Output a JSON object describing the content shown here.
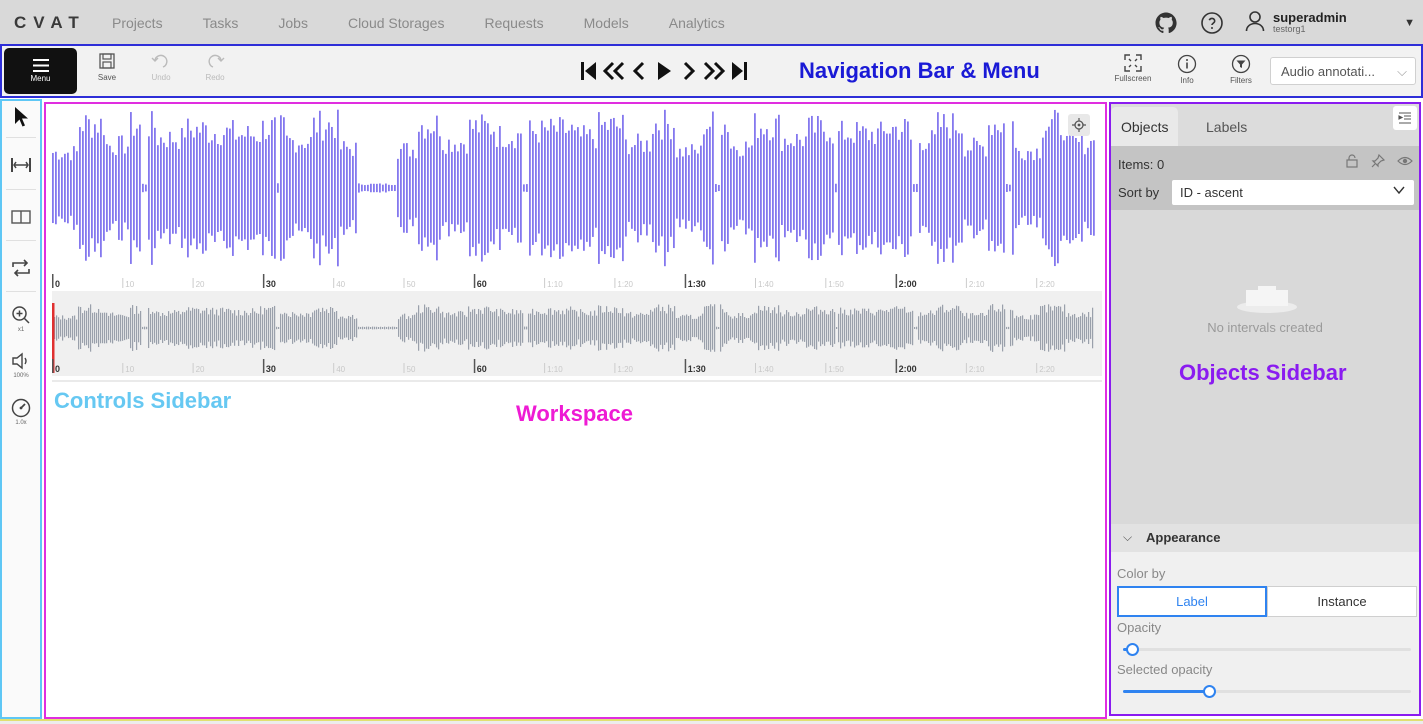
{
  "header": {
    "logo": "CVAT",
    "nav": [
      "Projects",
      "Tasks",
      "Jobs",
      "Cloud Storages",
      "Requests",
      "Models",
      "Analytics"
    ],
    "user": {
      "name": "superadmin",
      "org": "testorg1"
    }
  },
  "toolbar": {
    "menu_label": "Menu",
    "save_label": "Save",
    "undo_label": "Undo",
    "redo_label": "Redo",
    "fullscreen_label": "Fullscreen",
    "info_label": "Info",
    "filters_label": "Filters",
    "mode_value": "Audio annotati..."
  },
  "controls": {
    "zoom_value": "x1",
    "volume_value": "100%",
    "speed_value": "1.0x"
  },
  "timeline": {
    "major_ticks": [
      "0",
      "30",
      "60",
      "1:30",
      "2:00"
    ],
    "minor_ticks": [
      "10",
      "20",
      "40",
      "50",
      "1:10",
      "1:20",
      "1:40",
      "1:50",
      "2:10",
      "2:20"
    ]
  },
  "objects_sidebar": {
    "tabs": [
      "Objects",
      "Labels"
    ],
    "items_label": "Items: 0",
    "sort_label": "Sort by",
    "sort_value": "ID - ascent",
    "empty_text": "No intervals created",
    "appearance": {
      "title": "Appearance",
      "color_by_label": "Color by",
      "color_by_options": [
        "Label",
        "Instance"
      ],
      "opacity_label": "Opacity",
      "opacity_value": 0.03,
      "selected_opacity_label": "Selected opacity",
      "selected_opacity_value": 0.3
    }
  },
  "annotations": {
    "navigation": "Navigation Bar & Menu",
    "controls": "Controls Sidebar",
    "workspace": "Workspace",
    "objects": "Objects Sidebar"
  },
  "colors": {
    "waveform_primary": "#8478ee",
    "waveform_overview": "#9aa0ab",
    "nav_border": "#2e2ed8",
    "controls_border": "#5ec7f5",
    "workspace_border": "#e02ee0",
    "objects_border": "#8a1bf0",
    "accent": "#2f83f0"
  }
}
